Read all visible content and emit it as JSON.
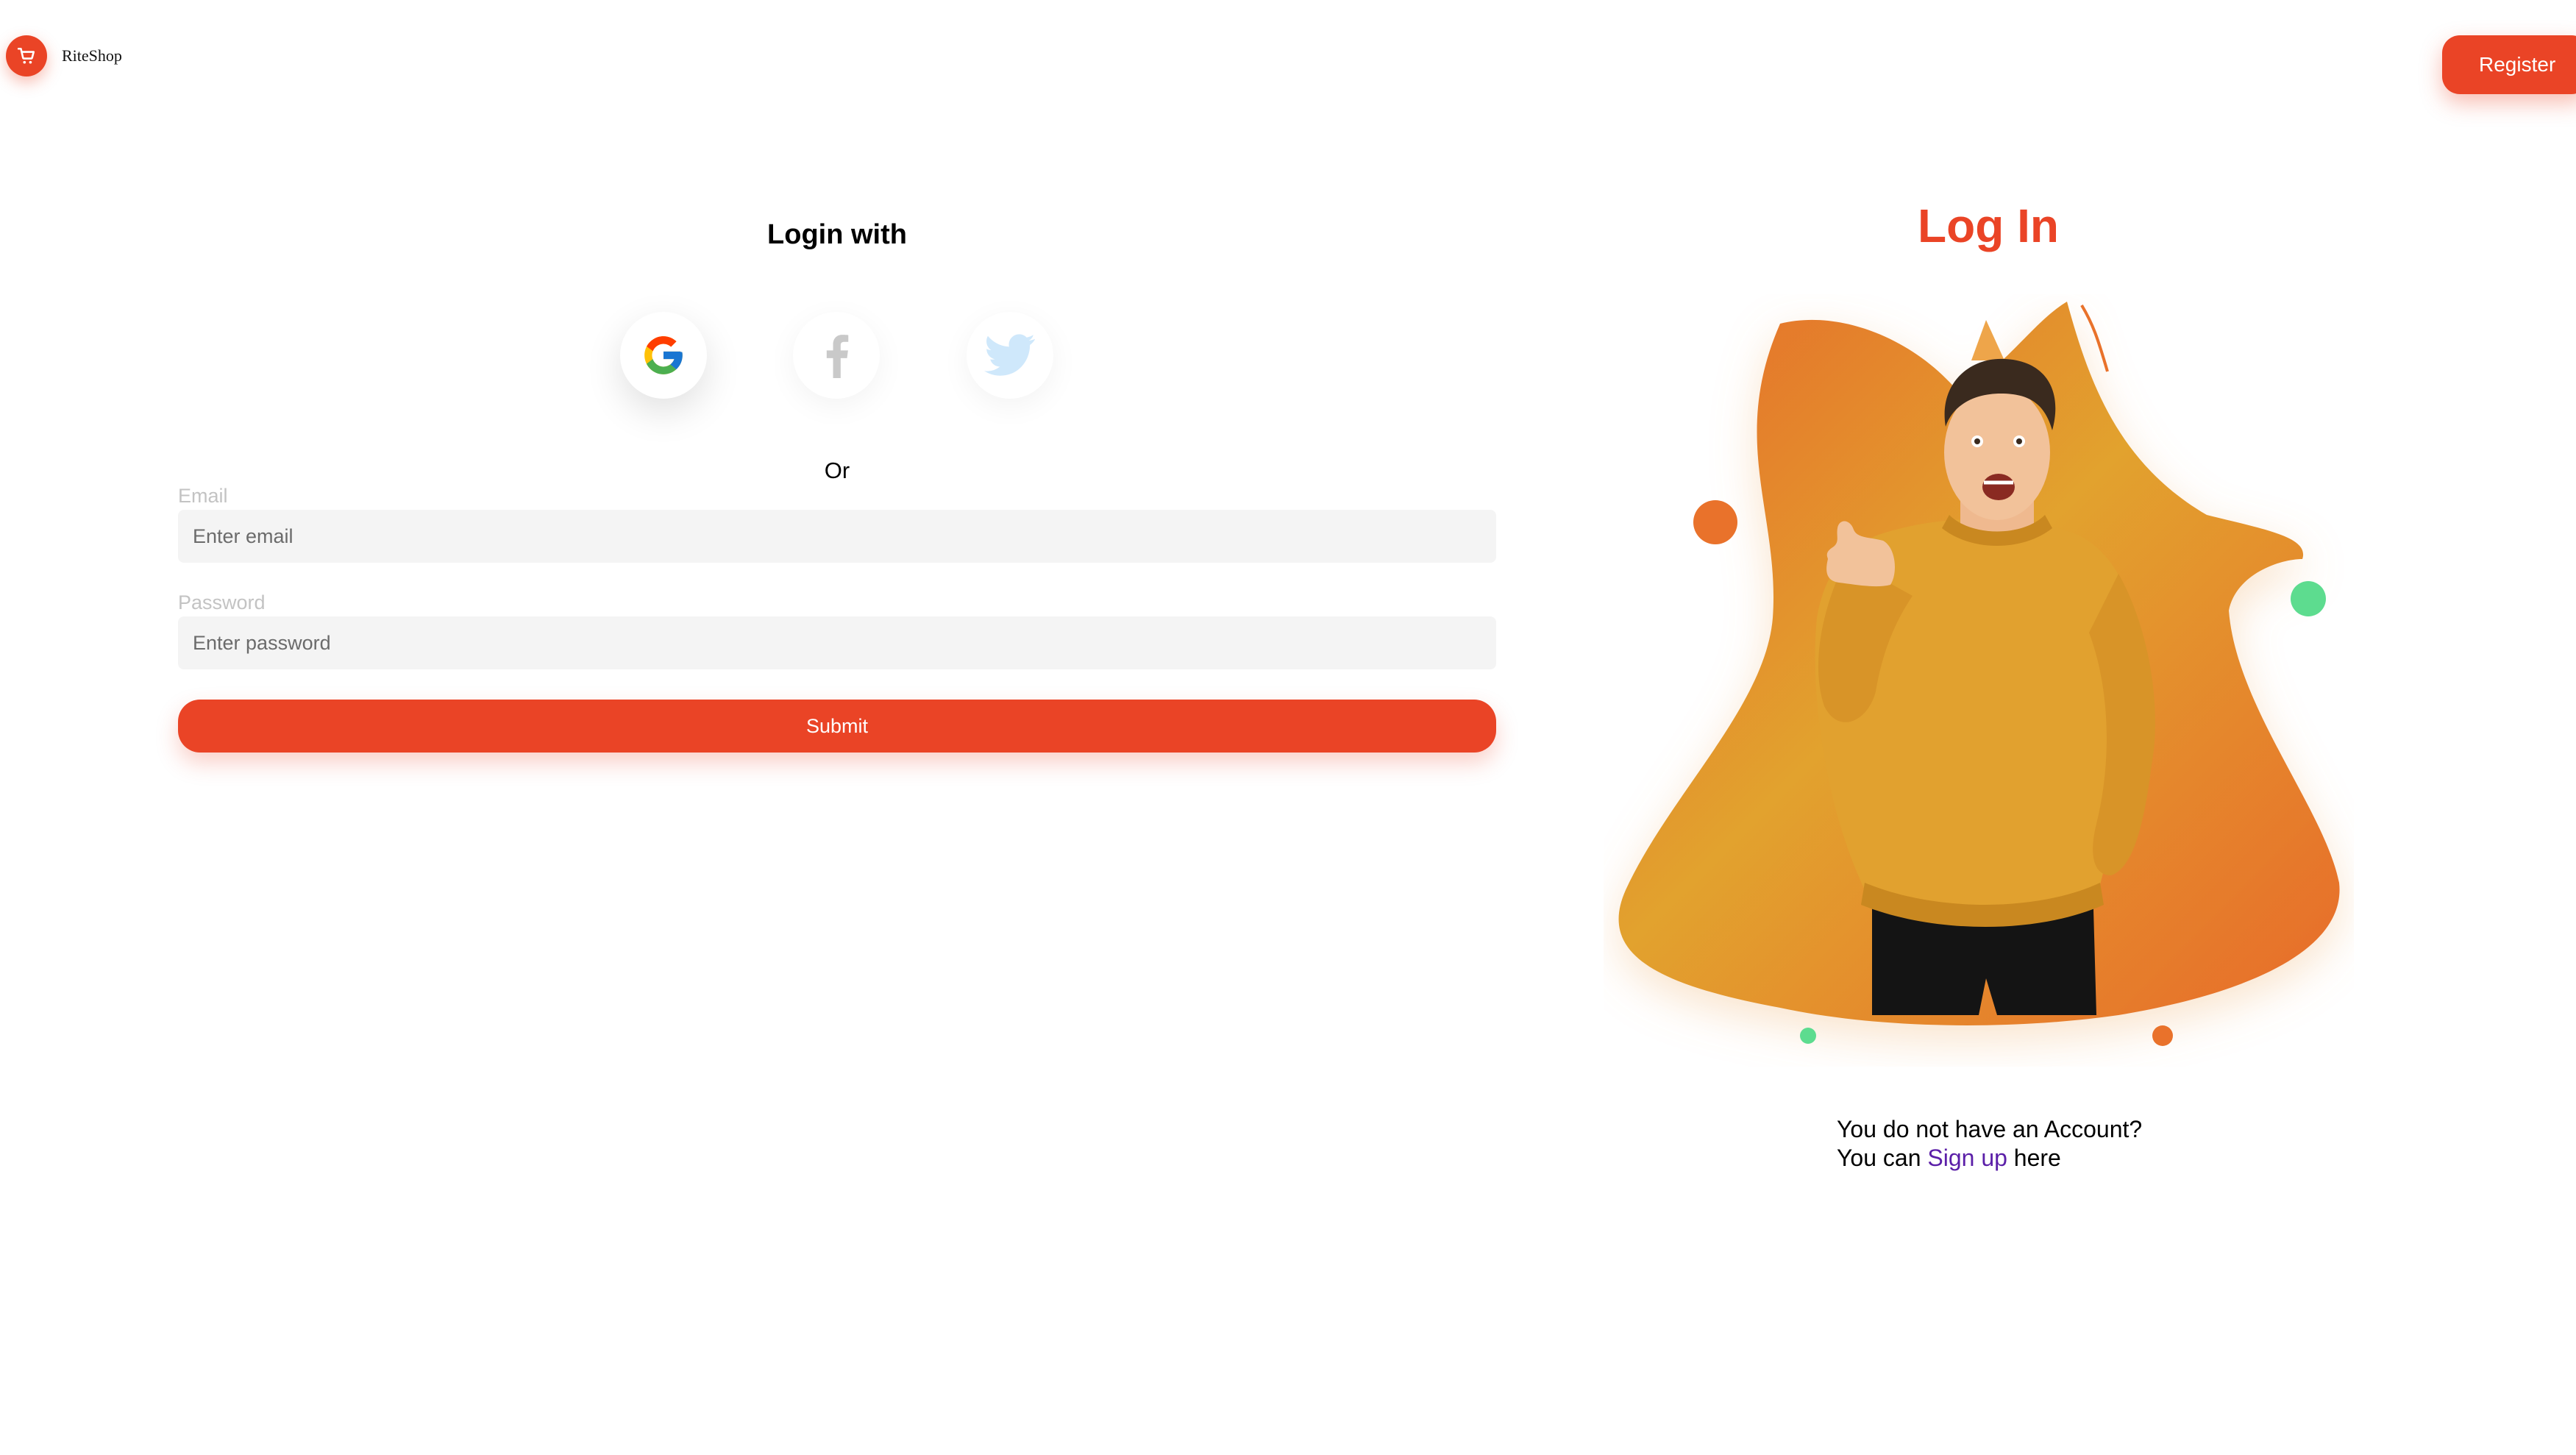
{
  "header": {
    "logo_icon": "shopping-cart-icon",
    "brand": "RiteShop",
    "register_label": "Register"
  },
  "login": {
    "heading": "Login with",
    "social": [
      {
        "name": "google",
        "icon": "google-icon"
      },
      {
        "name": "facebook",
        "icon": "facebook-icon"
      },
      {
        "name": "twitter",
        "icon": "twitter-icon"
      }
    ],
    "or_text": "Or",
    "email_label": "Email",
    "email_placeholder": "Enter email",
    "password_label": "Password",
    "password_placeholder": "Enter password",
    "submit_label": "Submit"
  },
  "hero": {
    "title": "Log In",
    "illustration": "smiling-man-pointing-illustration",
    "signup_line1": "You do not have an Account?",
    "signup_prefix": "You can ",
    "signup_link": "Sign up",
    "signup_suffix": " here"
  },
  "colors": {
    "accent": "#ea4426",
    "link": "#5b1fa8",
    "input_bg": "#f4f4f4",
    "blob_orange": "#e9722b",
    "blob_gold": "#e2a22d",
    "dot_green": "#5ddc8f"
  }
}
